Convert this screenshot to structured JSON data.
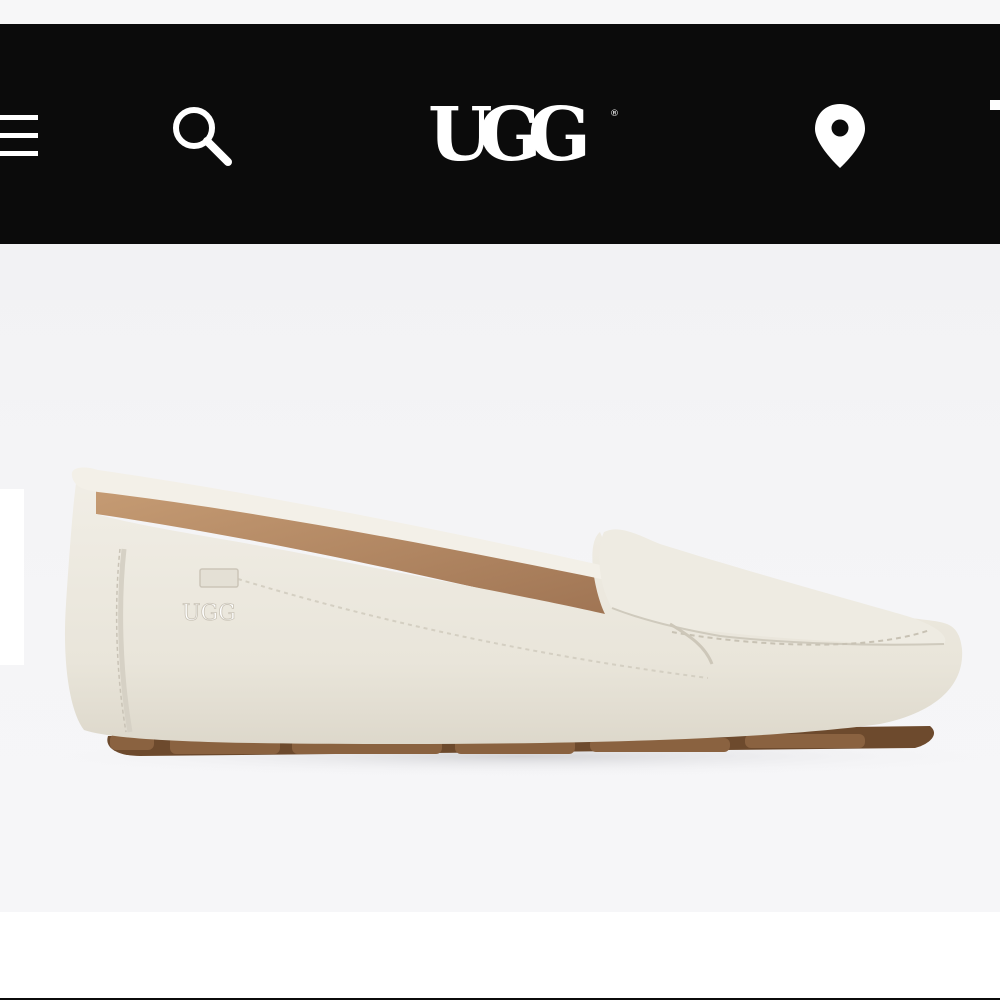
{
  "header": {
    "brand": "UGG",
    "icons": {
      "menu": "hamburger-menu-icon",
      "search": "search-icon",
      "store_locator": "map-pin-icon"
    },
    "background_color": "#0b0b0b",
    "icon_color": "#ffffff"
  },
  "product": {
    "logo_text": "UGG",
    "shoe_color": "#ece9e0",
    "lining_color": "#b98e68",
    "sole_color": "#7a5534"
  }
}
